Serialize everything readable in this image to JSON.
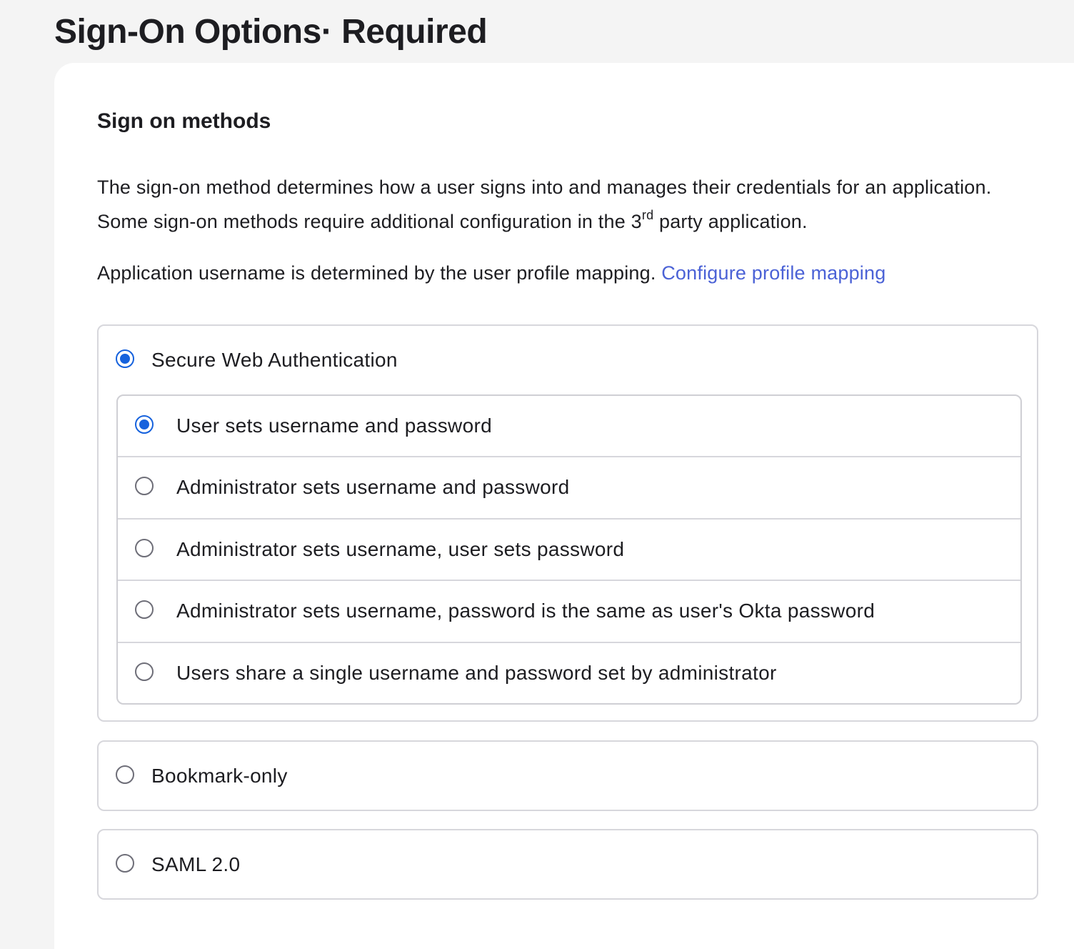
{
  "page": {
    "title": "Sign-On Options· Required"
  },
  "section": {
    "title": "Sign on methods",
    "description_part1": "The sign-on method determines how a user signs into and manages their credentials for an application. Some sign-on methods require additional configuration in the 3",
    "description_sup": "rd",
    "description_part2": " party application.",
    "mapping_text": "Application username is determined by the user profile mapping. ",
    "mapping_link": "Configure profile mapping"
  },
  "methods": [
    {
      "label": "Secure Web Authentication",
      "selected": true,
      "sub_options": [
        {
          "label": "User sets username and password",
          "selected": true
        },
        {
          "label": "Administrator sets username and password",
          "selected": false
        },
        {
          "label": "Administrator sets username, user sets password",
          "selected": false
        },
        {
          "label": "Administrator sets username, password is the same as user's Okta password",
          "selected": false
        },
        {
          "label": "Users share a single username and password set by administrator",
          "selected": false
        }
      ]
    },
    {
      "label": "Bookmark-only",
      "selected": false
    },
    {
      "label": "SAML 2.0",
      "selected": false
    }
  ],
  "colors": {
    "accent": "#1662dd",
    "link": "#4b62d6",
    "page_bg": "#f4f4f4",
    "card_bg": "#ffffff",
    "border": "#d7d7dc"
  },
  "icons": {
    "radio_selected": "radio-selected-icon",
    "radio_unselected": "radio-unselected-icon"
  }
}
